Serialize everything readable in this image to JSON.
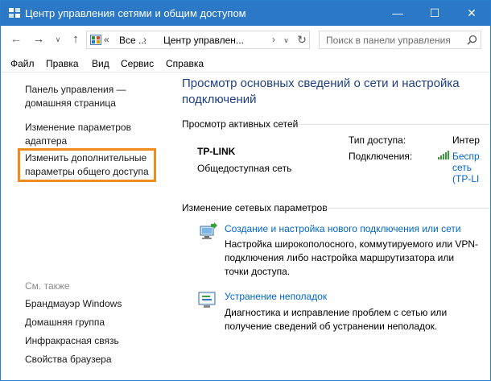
{
  "window": {
    "title": "Центр управления сетями и общим доступом",
    "controls": {
      "minimize": "—",
      "maximize": "☐",
      "close": "✕"
    }
  },
  "nav": {
    "back": "←",
    "forward": "→",
    "recent": "∨",
    "up": "↑",
    "address": {
      "chevron": "«",
      "segment1": "Все ...",
      "separator1": "›",
      "segment2": "Центр управлен...",
      "separator2": "›",
      "dropdown": "∨",
      "refresh": "↻"
    },
    "search_placeholder": "Поиск в панели управления"
  },
  "menu": [
    "Файл",
    "Правка",
    "Вид",
    "Сервис",
    "Справка"
  ],
  "sidebar": {
    "links": [
      {
        "line1": "Панель управления —",
        "line2": "домашняя страница"
      },
      {
        "line1": "Изменение параметров",
        "line2": "адаптера"
      },
      {
        "line1": "Изменить дополнительные",
        "line2": "параметры общего доступа"
      }
    ],
    "see_also_label": "См. также",
    "see_also": [
      "Брандмауэр Windows",
      "Домашняя группа",
      "Инфракрасная связь",
      "Свойства браузера"
    ]
  },
  "main": {
    "title": "Просмотр основных сведений о сети и настройка подключений",
    "active_networks": {
      "heading": "Просмотр активных сетей",
      "network_name": "TP-LINK",
      "network_type": "Общедоступная сеть",
      "access_type_label": "Тип доступа:",
      "access_type_value": "Интер",
      "connections_label": "Подключения:",
      "connection_line1": "Беспр",
      "connection_line2": "сеть",
      "connection_line3": "(TP-LI"
    },
    "change_settings": {
      "heading": "Изменение сетевых параметров",
      "tasks": [
        {
          "icon": "network-setup-icon",
          "link": "Создание и настройка нового подключения или сети",
          "desc": "Настройка широкополосного, коммутируемого или VPN-подключения либо настройка маршрутизатора или точки доступа."
        },
        {
          "icon": "troubleshoot-icon",
          "link": "Устранение неполадок",
          "desc": "Диагностика и исправление проблем с сетью или получение сведений об устранении неполадок."
        }
      ]
    }
  },
  "colors": {
    "titlebar": "#2b78c7",
    "link": "#0066cc",
    "heading": "#1e3f87",
    "highlight": "#f08c1e"
  }
}
